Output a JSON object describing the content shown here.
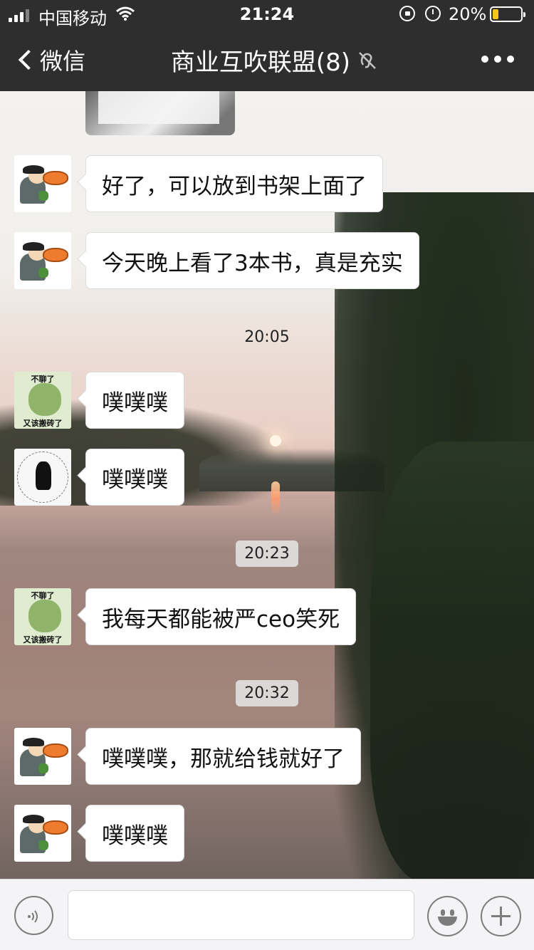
{
  "status_bar": {
    "carrier": "中国移动",
    "time": "21:24",
    "battery_percent": "20%",
    "battery_level": 0.2,
    "icons": [
      "signal-icon",
      "wifi-icon",
      "rotation-lock-icon",
      "alarm-icon",
      "battery-icon"
    ]
  },
  "nav": {
    "back_label": "微信",
    "title": "商业互吹联盟(8)",
    "title_icon": "mute-ear-icon",
    "more_icon": "more-dots-icon"
  },
  "messages": [
    {
      "type": "image",
      "avatar": "none",
      "content": ""
    },
    {
      "type": "text",
      "avatar": "goose",
      "text": "好了，可以放到书架上面了"
    },
    {
      "type": "text",
      "avatar": "goose",
      "text": "今天晚上看了3本书，真是充实"
    },
    {
      "type": "time",
      "text": "20:05"
    },
    {
      "type": "text",
      "avatar": "frog",
      "avatar_text_top": "不聊了",
      "avatar_text_bottom": "又该搬砖了",
      "text": "噗噗噗"
    },
    {
      "type": "text",
      "avatar": "sketch",
      "text": "噗噗噗"
    },
    {
      "type": "time",
      "text": "20:23"
    },
    {
      "type": "text",
      "avatar": "frog",
      "avatar_text_top": "不聊了",
      "avatar_text_bottom": "又该搬砖了",
      "text": "我每天都能被严ceo笑死"
    },
    {
      "type": "time",
      "text": "20:32"
    },
    {
      "type": "text",
      "avatar": "goose",
      "text": "噗噗噗，那就给钱就好了"
    },
    {
      "type": "text",
      "avatar": "goose",
      "text": "噗噗噗"
    }
  ],
  "input_bar": {
    "voice_icon": "voice-icon",
    "emoji_icon": "emoji-icon",
    "plus_icon": "plus-icon",
    "input_value": ""
  },
  "colors": {
    "nav_bg": "#2e2e2e",
    "bubble_bg": "#ffffff",
    "battery_fill": "#f5c518"
  }
}
